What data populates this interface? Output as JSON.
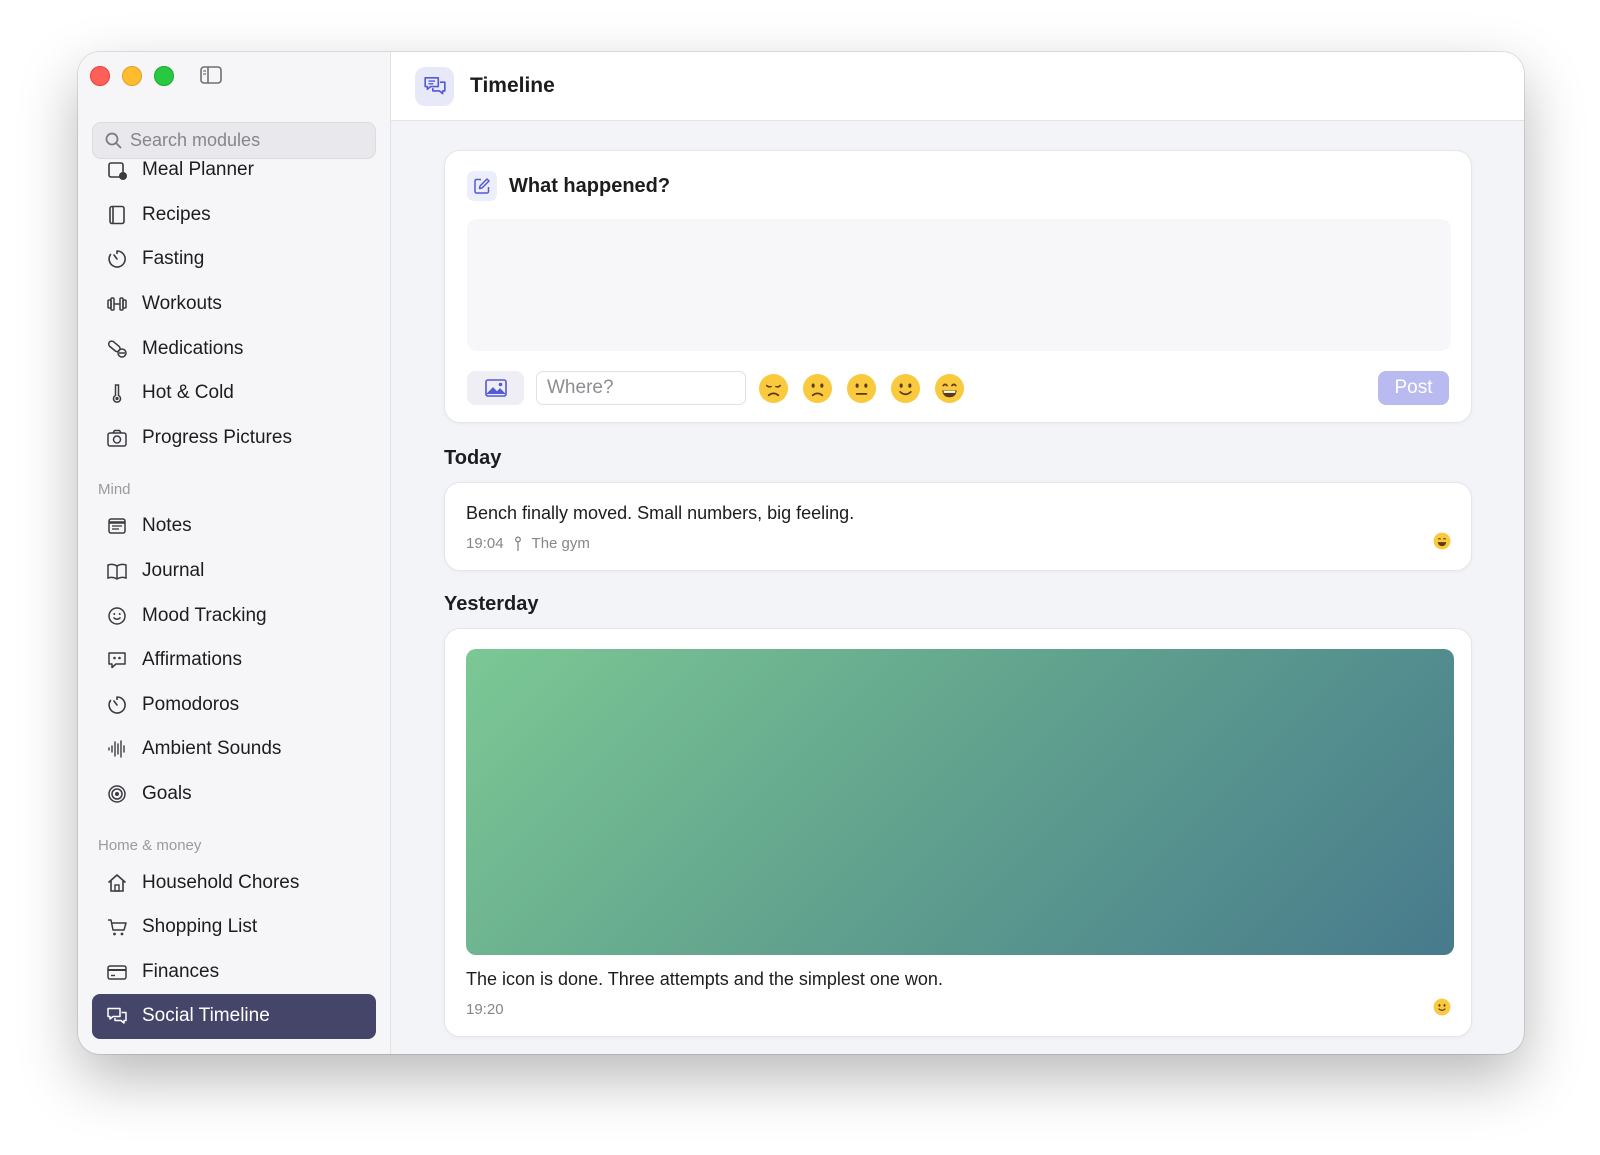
{
  "sidebar": {
    "search_placeholder": "Search modules",
    "items_top": [
      {
        "label": "Meal Planner",
        "icon": "meal-planner-icon"
      },
      {
        "label": "Recipes",
        "icon": "book-icon"
      },
      {
        "label": "Fasting",
        "icon": "timer-icon"
      },
      {
        "label": "Workouts",
        "icon": "dumbbell-icon"
      },
      {
        "label": "Medications",
        "icon": "pill-icon"
      },
      {
        "label": "Hot & Cold",
        "icon": "thermometer-icon"
      },
      {
        "label": "Progress Pictures",
        "icon": "camera-icon"
      }
    ],
    "section_mind": "Mind",
    "items_mind": [
      {
        "label": "Notes",
        "icon": "notes-icon"
      },
      {
        "label": "Journal",
        "icon": "open-book-icon"
      },
      {
        "label": "Mood Tracking",
        "icon": "smiley-icon"
      },
      {
        "label": "Affirmations",
        "icon": "quote-bubble-icon"
      },
      {
        "label": "Pomodoros",
        "icon": "timer-icon"
      },
      {
        "label": "Ambient Sounds",
        "icon": "waveform-icon"
      },
      {
        "label": "Goals",
        "icon": "target-icon"
      }
    ],
    "section_home": "Home & money",
    "items_home": [
      {
        "label": "Household Chores",
        "icon": "house-icon"
      },
      {
        "label": "Shopping List",
        "icon": "cart-icon"
      },
      {
        "label": "Finances",
        "icon": "card-icon"
      },
      {
        "label": "Social Timeline",
        "icon": "chat-bubbles-icon",
        "active": true
      }
    ]
  },
  "header": {
    "title": "Timeline",
    "icon": "chat-bubbles-icon"
  },
  "composer": {
    "title": "What happened?",
    "where_placeholder": "Where?",
    "moods": [
      "very-sad",
      "sad",
      "neutral",
      "happy",
      "very-happy"
    ],
    "post_label": "Post"
  },
  "timeline": [
    {
      "day": "Today",
      "posts": [
        {
          "text": "Bench finally moved. Small numbers, big feeling.",
          "time": "19:04",
          "location": "The gym",
          "mood": "very-happy"
        }
      ]
    },
    {
      "day": "Yesterday",
      "posts": [
        {
          "text": "The icon is done. Three attempts and the simplest one won.",
          "time": "19:20",
          "mood": "happy",
          "has_image": true
        }
      ]
    }
  ],
  "colors": {
    "accent": "#45456a",
    "post_button": "#b9bbf0",
    "image_gradient_start": "#7cc894",
    "image_gradient_end": "#477a8d"
  }
}
